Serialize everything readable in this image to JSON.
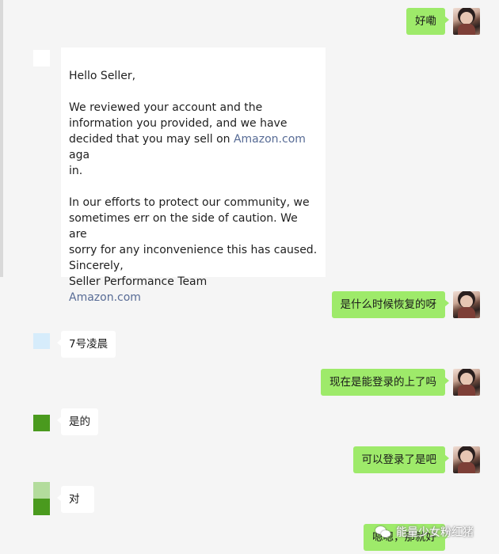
{
  "messages": [
    {
      "side": "right",
      "text": "好嘞"
    },
    {
      "side": "left",
      "type": "email",
      "email": {
        "greeting": "Hello Seller,",
        "p1_line1": "We reviewed your account and the",
        "p1_line2": "information you provided, and we have",
        "p1_line3_pre": "decided that you may sell on ",
        "p1_link": "Amazon.com",
        "p1_line3_post": " aga",
        "p1_line4": "in.",
        "p2_line1": "In our efforts to protect our community, we",
        "p2_line2": "sometimes err on the side of caution. We are",
        "p2_line3": "sorry for any inconvenience this has caused.",
        "sign_line1": "Sincerely,",
        "sign_line2": "Seller Performance Team",
        "sign_link": "Amazon.com"
      }
    },
    {
      "side": "right",
      "text": "是什么时候恢复的呀"
    },
    {
      "side": "left",
      "text": "7号凌晨"
    },
    {
      "side": "right",
      "text": "现在是能登录的上了吗"
    },
    {
      "side": "left",
      "text": "是的"
    },
    {
      "side": "right",
      "text": "可以登录了是吧"
    },
    {
      "side": "left",
      "text": "对"
    },
    {
      "side": "right",
      "text": "嗯嗯，那就好"
    }
  ],
  "watermark": {
    "text": "能量少女粉红猪"
  },
  "colors": {
    "background": "#f5f5f5",
    "bubble_outgoing": "#9eea6a",
    "bubble_incoming": "#ffffff",
    "link": "#576b95",
    "contact_avatar_green": "#4a9a1e",
    "contact_avatar_blue": "#d6ecfb"
  },
  "icons": {
    "user_avatar": "user-avatar-icon",
    "contact_avatar": "contact-avatar-icon",
    "watermark": "wechat-logo-icon"
  }
}
